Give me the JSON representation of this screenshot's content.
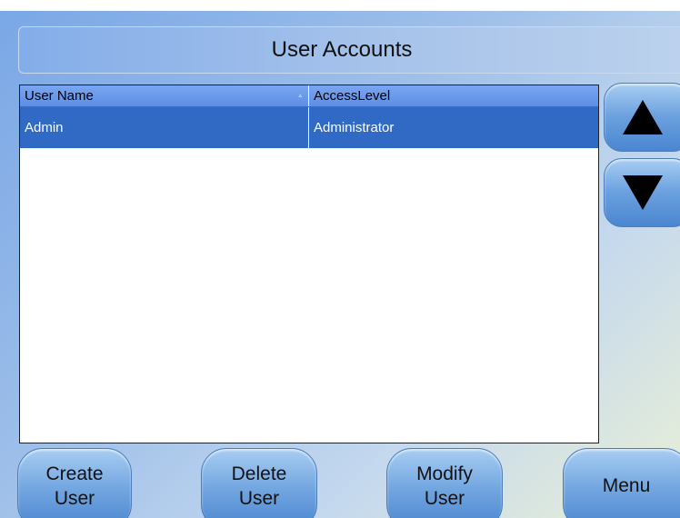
{
  "window": {
    "title": "User Accounts"
  },
  "grid": {
    "columns": [
      "User Name",
      "AccessLevel"
    ],
    "sort_indicator": "▵",
    "rows": [
      {
        "user_name": "Admin",
        "access_level": "Administrator",
        "selected": true
      }
    ]
  },
  "scroll": {
    "up_icon": "arrow-up-icon",
    "down_icon": "arrow-down-icon"
  },
  "buttons": {
    "create": {
      "line1": "Create",
      "line2": "User"
    },
    "delete": {
      "line1": "Delete",
      "line2": "User"
    },
    "modify": {
      "line1": "Modify",
      "line2": "User"
    },
    "menu": {
      "label": "Menu"
    }
  },
  "colors": {
    "selection": "#316ac5",
    "header": "#6a98ea",
    "button": "#6aa0de"
  }
}
